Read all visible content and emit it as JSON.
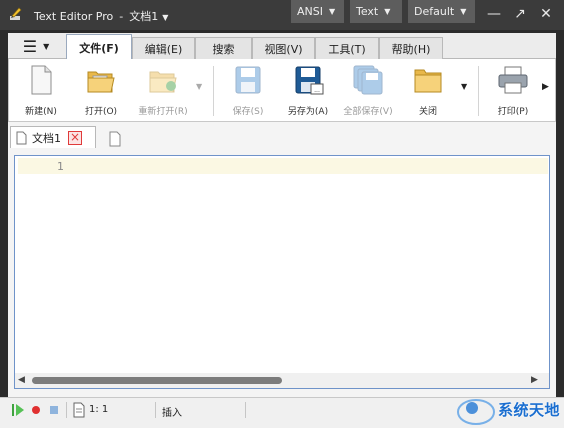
{
  "window": {
    "app_name": "Text Editor Pro",
    "separator": "-",
    "doc_name": "文档1",
    "dropdown_glyph": "▼"
  },
  "title_buttons": {
    "encoding": "ANSI",
    "syntax": "Text",
    "theme": "Default"
  },
  "window_controls": {
    "minimize": "—",
    "maximize": "↗",
    "close": "✕"
  },
  "menu_button": {
    "icon": "hamburger-icon",
    "glyph": "☰"
  },
  "ribbon_tabs": [
    {
      "label": "文件(F)",
      "active": true
    },
    {
      "label": "编辑(E)",
      "active": false
    },
    {
      "label": "搜索",
      "active": false
    },
    {
      "label": "视图(V)",
      "active": false
    },
    {
      "label": "工具(T)",
      "active": false
    },
    {
      "label": "帮助(H)",
      "active": false
    }
  ],
  "ribbon_buttons": [
    {
      "label": "新建(N)",
      "icon": "new-file-icon",
      "enabled": true
    },
    {
      "label": "打开(O)",
      "icon": "open-folder-icon",
      "enabled": true
    },
    {
      "label": "重新打开(R)",
      "icon": "reopen-folder-icon",
      "enabled": false
    },
    {
      "label": "保存(S)",
      "icon": "save-icon",
      "enabled": false
    },
    {
      "label": "另存为(A)",
      "icon": "save-as-icon",
      "enabled": true
    },
    {
      "label": "全部保存(V)",
      "icon": "save-all-icon",
      "enabled": false
    },
    {
      "label": "关闭",
      "icon": "close-folder-icon",
      "enabled": true
    },
    {
      "label": "打印(P)",
      "icon": "printer-icon",
      "enabled": true
    }
  ],
  "document_tab": {
    "label": "文档1",
    "close_glyph": "×"
  },
  "editor": {
    "line_number": "1",
    "content": ""
  },
  "scrollbar": {
    "left_glyph": "◀",
    "right_glyph": "▶"
  },
  "status_bar": {
    "cursor_position": "1: 1",
    "insert_mode": "插入"
  },
  "watermark": {
    "text": "系统天地"
  },
  "colors": {
    "titlebar_bg": "#3b3b3b",
    "title_button_bg": "#5d5d5d",
    "editor_border": "#6f93c9",
    "current_line": "#fbf8e3",
    "tab_close_red": "#e03a3a"
  }
}
